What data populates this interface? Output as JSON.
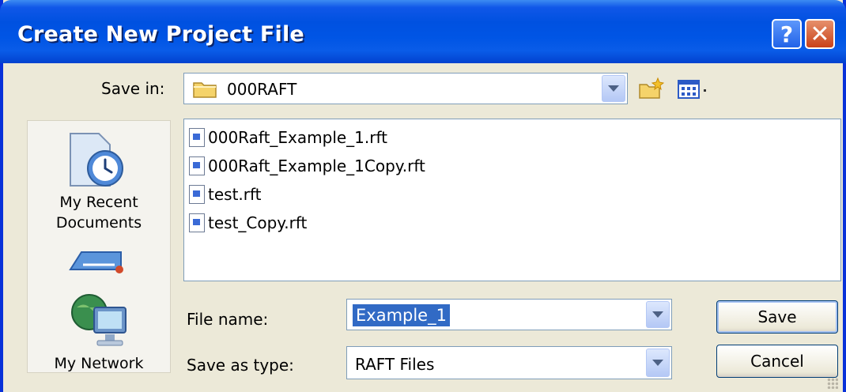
{
  "window": {
    "title": "Create New Project File"
  },
  "save_in": {
    "label": "Save in:",
    "value": "000RAFT"
  },
  "places": [
    {
      "label_line1": "My Recent",
      "label_line2": "Documents"
    },
    {
      "label_line1": "My Network",
      "label_line2": ""
    }
  ],
  "files": [
    {
      "name": "000Raft_Example_1.rft"
    },
    {
      "name": "000Raft_Example_1Copy.rft"
    },
    {
      "name": "test.rft"
    },
    {
      "name": "test_Copy.rft"
    }
  ],
  "file_name": {
    "label": "File name:",
    "value": "Example_1"
  },
  "save_as_type": {
    "label": "Save as type:",
    "value": "RAFT Files"
  },
  "buttons": {
    "save": "Save",
    "cancel": "Cancel"
  },
  "colors": {
    "title_bar": "#0055e5",
    "selection": "#316ac5",
    "dialog_bg": "#ece9d8"
  }
}
